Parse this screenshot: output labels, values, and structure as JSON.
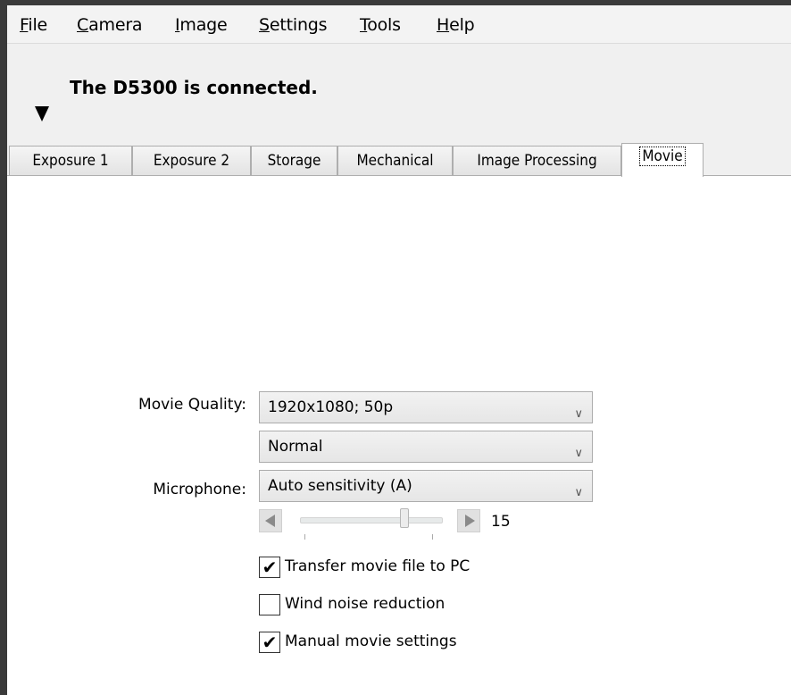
{
  "menu": [
    {
      "accel": "F",
      "rest": "ile"
    },
    {
      "accel": "C",
      "rest": "amera"
    },
    {
      "accel": "I",
      "rest": "mage"
    },
    {
      "accel": "S",
      "rest": "ettings"
    },
    {
      "accel": "T",
      "rest": "ools"
    },
    {
      "accel": "H",
      "rest": "elp"
    }
  ],
  "status": {
    "text": "The D5300 is connected."
  },
  "tabs": [
    "Exposure 1",
    "Exposure 2",
    "Storage",
    "Mechanical",
    "Image Processing",
    "Movie"
  ],
  "active_tab": "Movie",
  "movie": {
    "quality_label": "Movie Quality:",
    "quality_value": "1920x1080; 50p",
    "compression_value": "Normal",
    "microphone_label": "Microphone:",
    "microphone_value": "Auto sensitivity (A)",
    "mic_level": {
      "value": "15",
      "position_fraction": 0.73
    },
    "checkboxes": [
      {
        "label": "Transfer movie file to PC",
        "checked": true,
        "mark": "✔"
      },
      {
        "label": "Wind noise reduction",
        "checked": false,
        "mark": ""
      },
      {
        "label": "Manual movie settings",
        "checked": true,
        "mark": "✔"
      }
    ]
  }
}
